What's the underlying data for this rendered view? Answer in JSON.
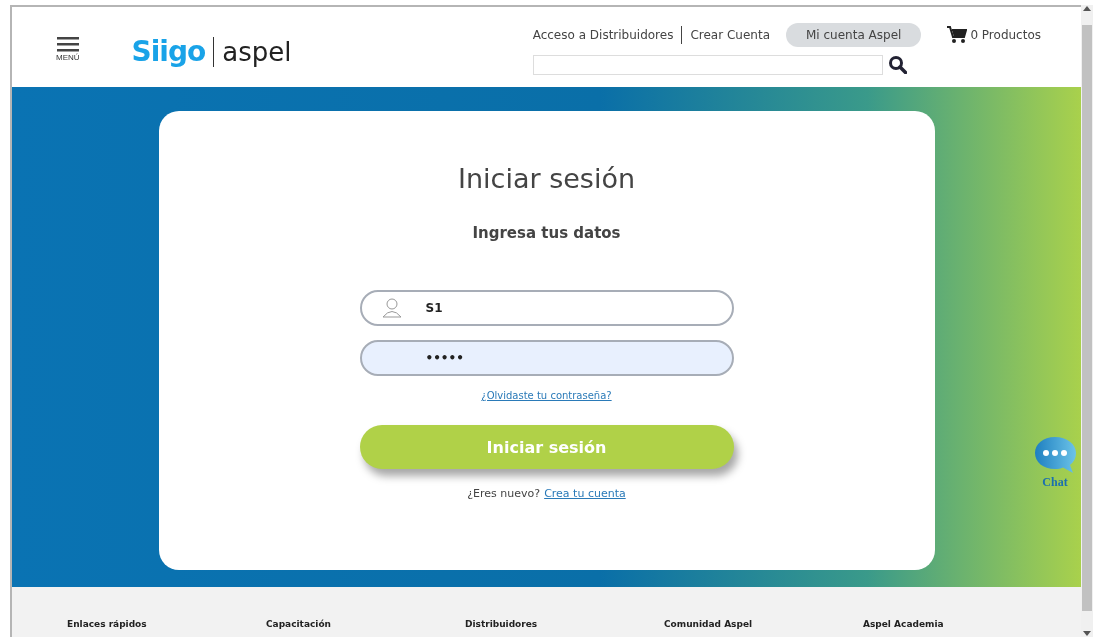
{
  "header": {
    "menu_label": "MENÚ",
    "logo_primary": "Siigo",
    "logo_secondary": "aspel",
    "links": [
      {
        "label": "Acceso a Distribuidores"
      },
      {
        "label": "Crear Cuenta"
      }
    ],
    "account_button": "Mi cuenta Aspel",
    "cart": "0 Productos"
  },
  "login": {
    "title": "Iniciar sesión",
    "subtitle": "Ingresa tus datos",
    "fields": [
      {
        "kind": "user",
        "value": "S1",
        "focused": false
      },
      {
        "kind": "password",
        "value": "•••••",
        "focused": true
      }
    ],
    "forgot_link": "¿Olvidaste tu contraseña?",
    "submit": "Iniciar sesión",
    "signup_prompt": "¿Eres nuevo?",
    "signup_link": "Crea tu cuenta"
  },
  "chat": {
    "label": "Chat"
  },
  "footer": {
    "columns": [
      "Enlaces rápidos",
      "Capacitación",
      "Distribuidores",
      "Comunidad Aspel",
      "Aspel Academia"
    ]
  }
}
